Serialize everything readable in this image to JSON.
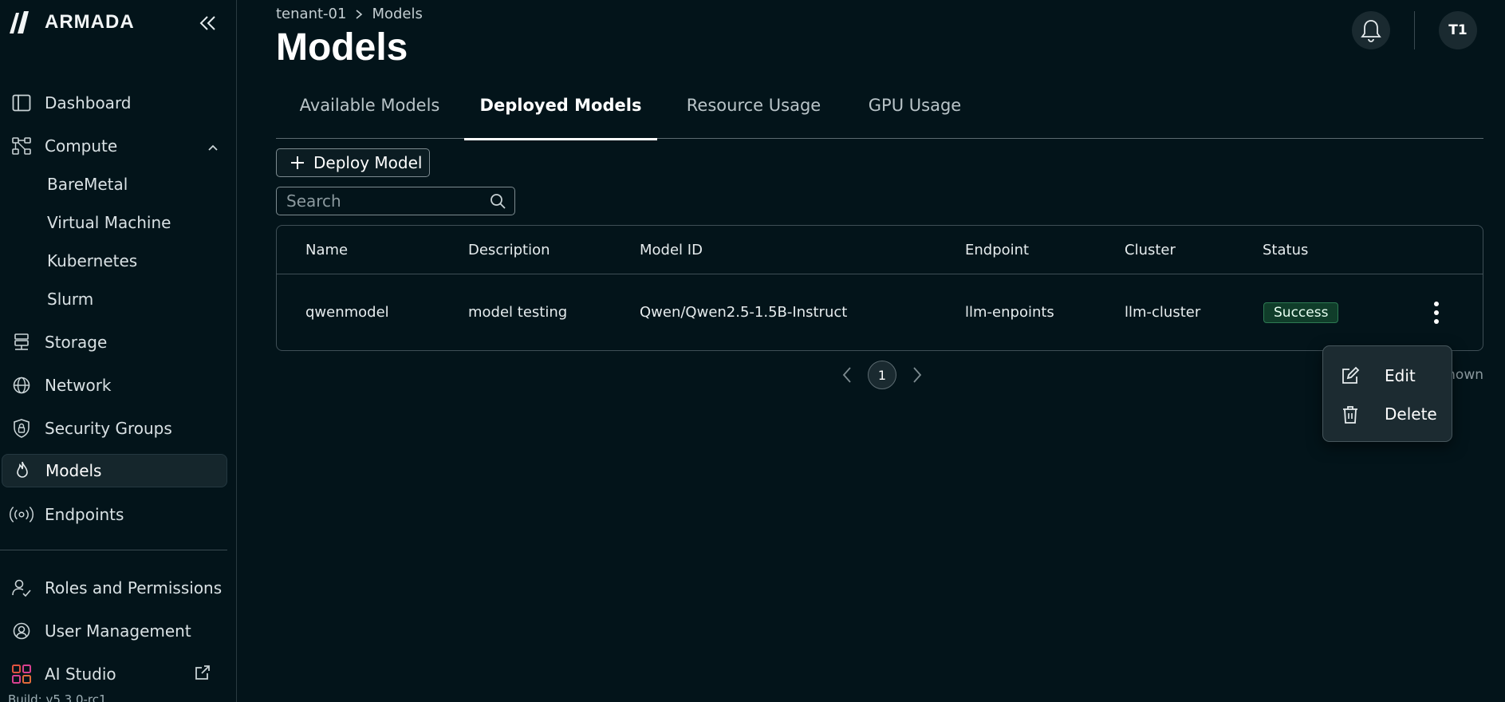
{
  "brand": {
    "name": "ARMADA"
  },
  "sidebar": {
    "items": [
      {
        "label": "Dashboard",
        "icon": "dashboard-icon"
      },
      {
        "label": "Compute",
        "icon": "compute-icon",
        "expanded": true
      },
      {
        "label": "BareMetal"
      },
      {
        "label": "Virtual Machine"
      },
      {
        "label": "Kubernetes"
      },
      {
        "label": "Slurm"
      },
      {
        "label": "Storage",
        "icon": "storage-icon"
      },
      {
        "label": "Network",
        "icon": "globe-icon"
      },
      {
        "label": "Security Groups",
        "icon": "lock-shield-icon"
      },
      {
        "label": "Models",
        "icon": "flame-icon",
        "active": true
      },
      {
        "label": "Endpoints",
        "icon": "broadcast-icon"
      }
    ],
    "footer_items": [
      {
        "label": "Roles and Permissions",
        "icon": "user-check-icon"
      },
      {
        "label": "User Management",
        "icon": "user-circle-icon"
      },
      {
        "label": "AI Studio",
        "icon": "grid-icon",
        "external": true
      }
    ],
    "build": "Build: v5.3.0-rc1"
  },
  "header": {
    "breadcrumb": [
      "tenant-01",
      "Models"
    ],
    "title": "Models",
    "avatar": "T1"
  },
  "tabs": [
    {
      "label": "Available Models"
    },
    {
      "label": "Deployed Models",
      "active": true
    },
    {
      "label": "Resource Usage"
    },
    {
      "label": "GPU Usage"
    }
  ],
  "toolbar": {
    "deploy_label": "Deploy Model",
    "search_placeholder": "Search"
  },
  "table": {
    "columns": [
      "Name",
      "Description",
      "Model ID",
      "Endpoint",
      "Cluster",
      "Status"
    ],
    "rows": [
      {
        "name": "qwenmodel",
        "description": "model testing",
        "model_id": "Qwen/Qwen2.5-1.5B-Instruct",
        "endpoint": "llm-enpoints",
        "cluster": "llm-cluster",
        "status": "Success"
      }
    ]
  },
  "pagination": {
    "current": "1",
    "shown_text": "hown"
  },
  "context_menu": {
    "items": [
      {
        "label": "Edit",
        "icon": "edit-icon"
      },
      {
        "label": "Delete",
        "icon": "trash-icon"
      }
    ]
  },
  "colors": {
    "background": "#03141a",
    "success": "#2d7a52",
    "panel": "#1c2b31"
  }
}
